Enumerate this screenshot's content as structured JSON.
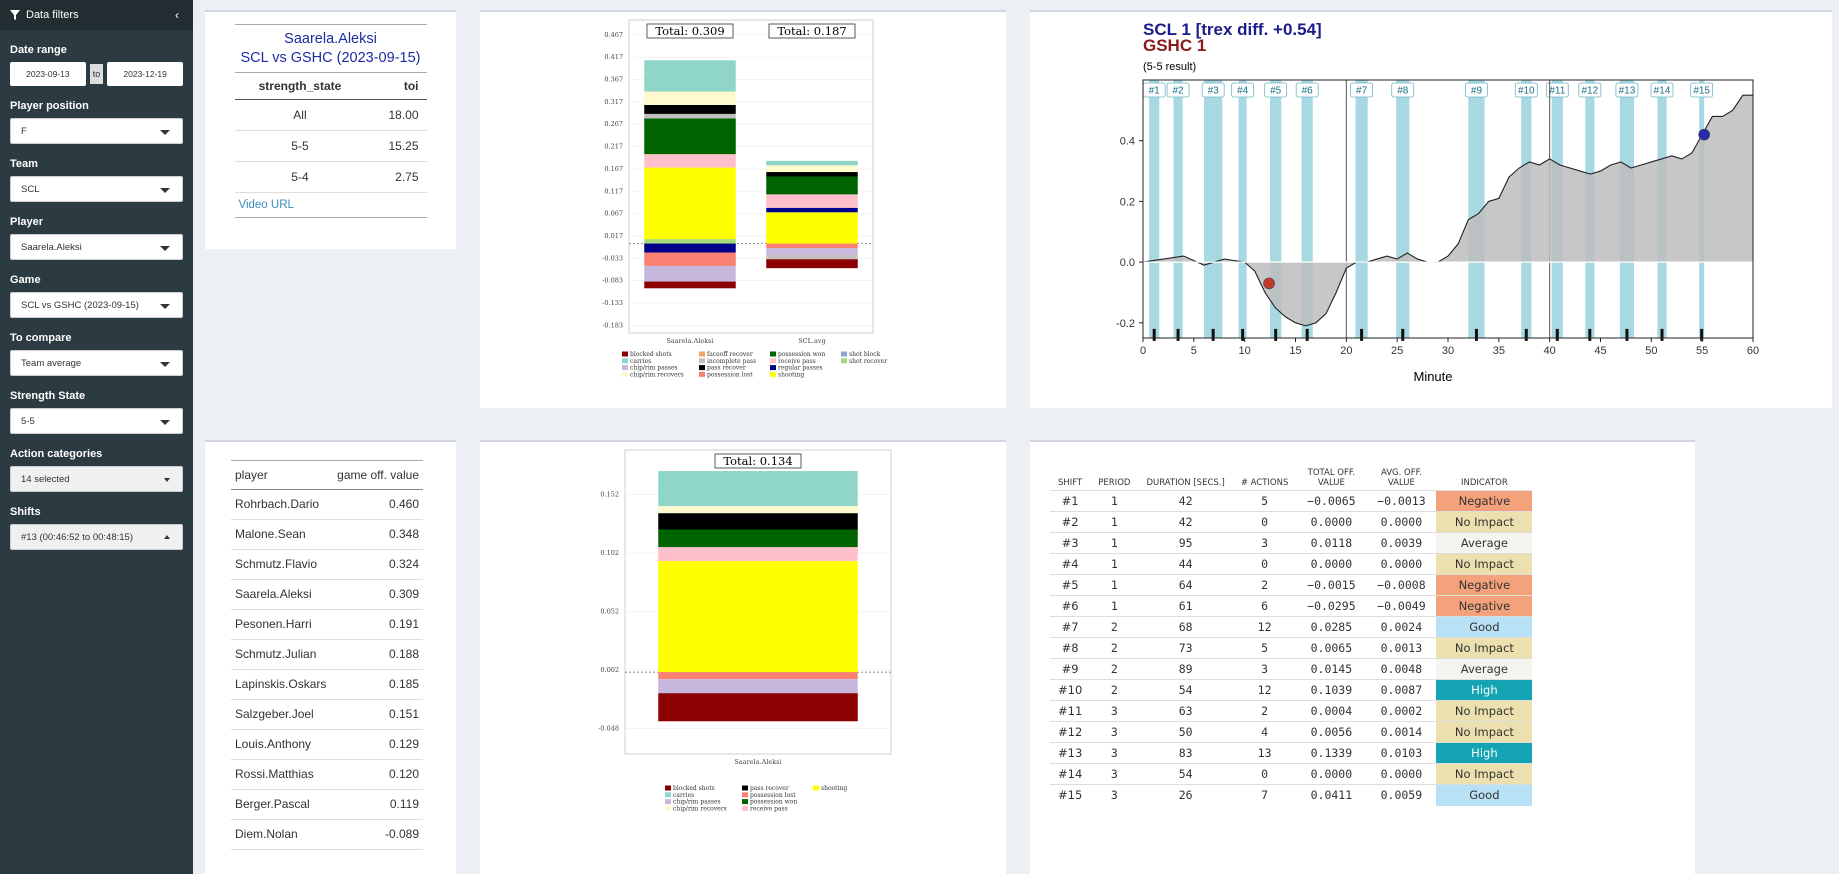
{
  "sidebar": {
    "title": "Data filters",
    "date_range": {
      "label": "Date range",
      "from": "2023-09-13",
      "to_label": "to",
      "to": "2023-12-19"
    },
    "player_position": {
      "label": "Player position",
      "value": "F"
    },
    "team": {
      "label": "Team",
      "value": "SCL"
    },
    "player": {
      "label": "Player",
      "value": "Saarela.Aleksi"
    },
    "game": {
      "label": "Game",
      "value": "SCL vs GSHC (2023-09-15)"
    },
    "to_compare": {
      "label": "To compare",
      "value": "Team average"
    },
    "strength_state": {
      "label": "Strength State",
      "value": "5-5"
    },
    "action_categories": {
      "label": "Action categories",
      "value": "14 selected"
    },
    "shifts": {
      "label": "Shifts",
      "value": "#13 (00:46:52 to 00:48:15)"
    }
  },
  "summary": {
    "player": "Saarela.Aleksi",
    "game": "SCL vs GSHC (2023-09-15)",
    "headers": [
      "strength_state",
      "toi"
    ],
    "rows": [
      [
        "All",
        "18.00"
      ],
      [
        "5-5",
        "15.25"
      ],
      [
        "5-4",
        "2.75"
      ]
    ],
    "video_link": "Video URL"
  },
  "players": {
    "headers": [
      "player",
      "game off. value"
    ],
    "rows": [
      [
        "Rohrbach.Dario",
        "0.460"
      ],
      [
        "Malone.Sean",
        "0.348"
      ],
      [
        "Schmutz.Flavio",
        "0.324"
      ],
      [
        "Saarela.Aleksi",
        "0.309"
      ],
      [
        "Pesonen.Harri",
        "0.191"
      ],
      [
        "Schmutz.Julian",
        "0.188"
      ],
      [
        "Lapinskis.Oskars",
        "0.185"
      ],
      [
        "Salzgeber.Joel",
        "0.151"
      ],
      [
        "Louis.Anthony",
        "0.129"
      ],
      [
        "Rossi.Matthias",
        "0.120"
      ],
      [
        "Berger.Pascal",
        "0.119"
      ],
      [
        "Diem.Nolan",
        "-0.089"
      ]
    ]
  },
  "colors": {
    "blocked shots": "#8b0000",
    "carries": "#8fd6c8",
    "chip/rim passes": "#c7b7dc",
    "chip/rim recovers": "#fffacd",
    "faceoff recover": "#f4a460",
    "incomplete pass": "#c0c0c0",
    "pass recover": "#000000",
    "possession lost": "#fa8072",
    "possession won": "#006400",
    "receive pass": "#ffc0cb",
    "regular passes": "#00008b",
    "shooting": "#ffff00",
    "shot block": "#87a7d0",
    "shot recover": "#a3d977"
  },
  "chart_data": [
    {
      "type": "bar",
      "stacked": true,
      "categories": [
        "Saarela.Aleksi",
        "SCL.avg"
      ],
      "totals": [
        "Total: 0.309",
        "Total: 0.187"
      ],
      "ylim": [
        -0.2,
        0.5
      ],
      "yticks": [
        0.467,
        0.417,
        0.367,
        0.317,
        0.267,
        0.217,
        0.167,
        0.117,
        0.067,
        0.017,
        -0.033,
        -0.083,
        -0.133,
        -0.183
      ],
      "ytick_labels": [
        "0.467",
        "0.417",
        "0.367",
        "0.317",
        "0.267",
        "0.217",
        "0.167",
        "0.117",
        "0.067",
        "0.017",
        "-0.033",
        "-0.083",
        "-0.133",
        "-0.183"
      ],
      "positive": [
        [
          [
            "shot recover",
            0.01
          ],
          [
            "shooting",
            0.16
          ],
          [
            "receive pass",
            0.03
          ],
          [
            "possession won",
            0.08
          ],
          [
            "incomplete pass",
            0.01
          ],
          [
            "pass recover",
            0.02
          ],
          [
            "chip/rim recovers",
            0.03
          ],
          [
            "carries",
            0.07
          ]
        ],
        [
          [
            "shooting",
            0.07
          ],
          [
            "regular passes",
            0.01
          ],
          [
            "receive pass",
            0.03
          ],
          [
            "possession won",
            0.04
          ],
          [
            "pass recover",
            0.01
          ],
          [
            "chip/rim recovers",
            0.015
          ],
          [
            "carries",
            0.01
          ]
        ]
      ],
      "negative": [
        [
          [
            "regular passes",
            -0.02
          ],
          [
            "possession lost",
            -0.03
          ],
          [
            "chip/rim passes",
            -0.035
          ],
          [
            "blocked shots",
            -0.015
          ]
        ],
        [
          [
            "possession lost",
            -0.01
          ],
          [
            "chip/rim passes",
            -0.015
          ],
          [
            "incomplete pass",
            -0.01
          ],
          [
            "blocked shots",
            -0.02
          ]
        ]
      ],
      "legend": [
        "blocked shots",
        "carries",
        "chip/rim passes",
        "chip/rim recovers",
        "faceoff recover",
        "incomplete pass",
        "pass recover",
        "possession lost",
        "possession won",
        "receive pass",
        "regular passes",
        "shooting",
        "shot block",
        "shot recover"
      ]
    },
    {
      "type": "bar",
      "stacked": true,
      "categories": [
        "Saarela.Aleksi"
      ],
      "totals": [
        "Total: 0.134"
      ],
      "ylim": [
        -0.07,
        0.19
      ],
      "yticks": [
        0.152,
        0.102,
        0.052,
        0.002,
        -0.048
      ],
      "ytick_labels": [
        "0.152",
        "0.102",
        "0.052",
        "0.002",
        "-0.048"
      ],
      "positive": [
        [
          [
            "shooting",
            0.095
          ],
          [
            "receive pass",
            0.012
          ],
          [
            "possession won",
            0.015
          ],
          [
            "pass recover",
            0.014
          ],
          [
            "chip/rim recovers",
            0.006
          ],
          [
            "carries",
            0.03
          ]
        ]
      ],
      "negative": [
        [
          [
            "possession lost",
            -0.006
          ],
          [
            "chip/rim passes",
            -0.012
          ],
          [
            "blocked shots",
            -0.024
          ]
        ]
      ],
      "legend": [
        "blocked shots",
        "carries",
        "chip/rim passes",
        "chip/rim recovers",
        "pass recover",
        "possession lost",
        "possession won",
        "receive pass",
        "shooting"
      ]
    },
    {
      "type": "area",
      "title_home": "SCL 1 [trex diff. +0.54]",
      "title_away": "GSHC 1",
      "subtitle": "(5-5 result)",
      "xlabel": "Minute",
      "xlim": [
        0,
        60
      ],
      "ylim": [
        -0.25,
        0.6
      ],
      "xticks": [
        0,
        5,
        10,
        15,
        20,
        25,
        30,
        35,
        40,
        45,
        50,
        55,
        60
      ],
      "yticks": [
        -0.2,
        0.0,
        0.2,
        0.4
      ],
      "ytick_labels": [
        "-0.2",
        "0.0",
        "0.2",
        "0.4"
      ],
      "period_lines": [
        20,
        40
      ],
      "shifts": [
        {
          "label": "#1",
          "start": 0.6,
          "end": 1.6
        },
        {
          "label": "#2",
          "start": 3.0,
          "end": 3.9
        },
        {
          "label": "#3",
          "start": 6.0,
          "end": 7.8
        },
        {
          "label": "#4",
          "start": 9.4,
          "end": 10.2
        },
        {
          "label": "#5",
          "start": 12.5,
          "end": 13.6
        },
        {
          "label": "#6",
          "start": 15.6,
          "end": 16.7
        },
        {
          "label": "#7",
          "start": 20.9,
          "end": 22.1
        },
        {
          "label": "#8",
          "start": 24.9,
          "end": 26.2
        },
        {
          "label": "#9",
          "start": 32.0,
          "end": 33.6
        },
        {
          "label": "#10",
          "start": 37.2,
          "end": 38.2
        },
        {
          "label": "#11",
          "start": 40.2,
          "end": 41.3
        },
        {
          "label": "#12",
          "start": 43.5,
          "end": 44.4
        },
        {
          "label": "#13",
          "start": 46.9,
          "end": 48.3
        },
        {
          "label": "#14",
          "start": 50.6,
          "end": 51.5
        },
        {
          "label": "#15",
          "start": 54.7,
          "end": 55.2
        }
      ],
      "x": [
        0,
        2,
        4,
        6,
        8,
        10,
        11,
        12,
        13,
        14,
        15,
        16,
        17,
        18,
        19,
        20,
        21,
        22,
        23,
        24,
        25,
        26,
        27,
        28,
        29,
        30,
        31,
        32,
        33,
        34,
        35,
        36,
        37,
        38,
        39,
        40,
        41,
        42,
        43,
        44,
        45,
        46,
        47,
        48,
        49,
        50,
        51,
        52,
        53,
        54,
        55,
        56,
        57,
        58,
        59,
        60
      ],
      "y": [
        0.0,
        0.01,
        0.02,
        -0.01,
        0.01,
        0.0,
        -0.03,
        -0.1,
        -0.15,
        -0.18,
        -0.2,
        -0.21,
        -0.2,
        -0.17,
        -0.1,
        -0.02,
        0.0,
        0.0,
        0.01,
        0.02,
        0.01,
        0.03,
        0.01,
        0.0,
        0.0,
        0.02,
        0.06,
        0.14,
        0.16,
        0.2,
        0.21,
        0.28,
        0.31,
        0.33,
        0.32,
        0.34,
        0.32,
        0.31,
        0.3,
        0.29,
        0.3,
        0.32,
        0.33,
        0.31,
        0.32,
        0.33,
        0.34,
        0.35,
        0.34,
        0.36,
        0.42,
        0.48,
        0.48,
        0.5,
        0.55,
        0.55
      ],
      "goals": [
        {
          "team": "away",
          "x": 12.4,
          "y": -0.07
        },
        {
          "team": "home",
          "x": 55.2,
          "y": 0.42
        }
      ]
    }
  ],
  "shifts_table": {
    "headers": [
      "SHIFT",
      "PERIOD",
      "DURATION [SECS.]",
      "# ACTIONS",
      "TOTAL OFF. VALUE",
      "AVG. OFF. VALUE",
      "INDICATOR"
    ],
    "rows": [
      [
        "#1",
        "1",
        "42",
        "5",
        "−0.0065",
        "−0.0013",
        "Negative"
      ],
      [
        "#2",
        "1",
        "42",
        "0",
        "0.0000",
        "0.0000",
        "No Impact"
      ],
      [
        "#3",
        "1",
        "95",
        "3",
        "0.0118",
        "0.0039",
        "Average"
      ],
      [
        "#4",
        "1",
        "44",
        "0",
        "0.0000",
        "0.0000",
        "No Impact"
      ],
      [
        "#5",
        "1",
        "64",
        "2",
        "−0.0015",
        "−0.0008",
        "Negative"
      ],
      [
        "#6",
        "1",
        "61",
        "6",
        "−0.0295",
        "−0.0049",
        "Negative"
      ],
      [
        "#7",
        "2",
        "68",
        "12",
        "0.0285",
        "0.0024",
        "Good"
      ],
      [
        "#8",
        "2",
        "73",
        "5",
        "0.0065",
        "0.0013",
        "No Impact"
      ],
      [
        "#9",
        "2",
        "89",
        "3",
        "0.0145",
        "0.0048",
        "Average"
      ],
      [
        "#10",
        "2",
        "54",
        "12",
        "0.1039",
        "0.0087",
        "High"
      ],
      [
        "#11",
        "3",
        "63",
        "2",
        "0.0004",
        "0.0002",
        "No Impact"
      ],
      [
        "#12",
        "3",
        "50",
        "4",
        "0.0056",
        "0.0014",
        "No Impact"
      ],
      [
        "#13",
        "3",
        "83",
        "13",
        "0.1339",
        "0.0103",
        "High"
      ],
      [
        "#14",
        "3",
        "54",
        "0",
        "0.0000",
        "0.0000",
        "No Impact"
      ],
      [
        "#15",
        "3",
        "26",
        "7",
        "0.0411",
        "0.0059",
        "Good"
      ]
    ],
    "indicator_colors": {
      "Negative": "#f4a27c",
      "No Impact": "#ece0ae",
      "Average": "#f6f4ee",
      "Good": "#b9e1f5",
      "High": "#16a4b4"
    }
  }
}
